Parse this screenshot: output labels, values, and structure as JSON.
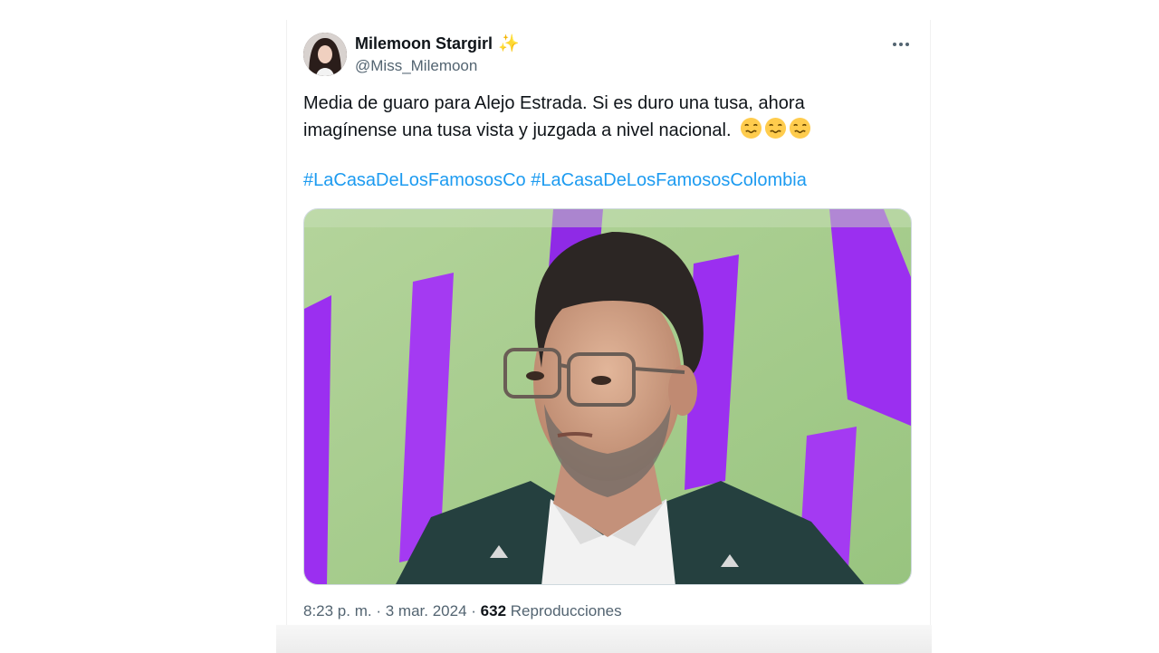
{
  "tweet": {
    "author": {
      "display_name": "Milemoon Stargirl",
      "handle": "@Miss_Milemoon",
      "badge_icon": "sparkles-icon"
    },
    "more_icon": "more-horizontal-icon",
    "text_line1": "Media de guaro para Alejo Estrada. Si es duro una tusa, ahora",
    "text_line2": "imagínense una tusa vista y juzgada a nivel nacional.",
    "emojis": [
      "woozy-face-icon",
      "woozy-face-icon",
      "woozy-face-icon"
    ],
    "hashtags": [
      "#LaCasaDeLosFamososCo",
      "#LaCasaDeLosFamososColombia"
    ],
    "media": {
      "description_icon": "photo-man-with-glasses",
      "colors": {
        "background_green": "#a9cf8f",
        "accent_purple": "#9b2ff0"
      }
    },
    "meta": {
      "time": "8:23 p. m.",
      "separator1": "·",
      "date": "3 mar. 2024",
      "separator2": "·",
      "views_count": "632",
      "views_label": "Reproducciones"
    }
  },
  "colors": {
    "text_primary": "#0f1419",
    "text_secondary": "#536471",
    "link": "#1d9bf0",
    "sparkle": "#f4c12b"
  }
}
